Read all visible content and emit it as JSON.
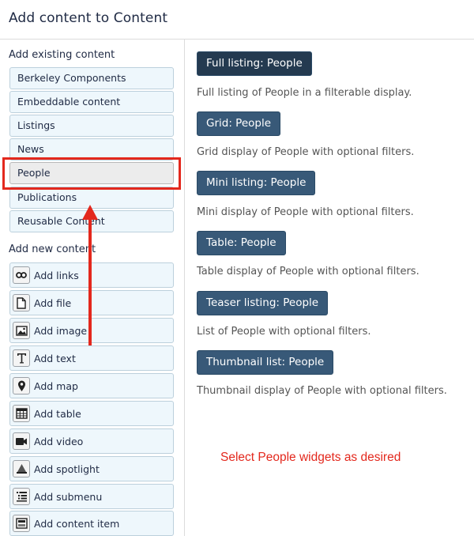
{
  "header": {
    "title": "Add content to Content"
  },
  "sidebar": {
    "existing_label": "Add existing content",
    "existing_items": [
      {
        "label": "Berkeley Components"
      },
      {
        "label": "Embeddable content"
      },
      {
        "label": "Listings"
      },
      {
        "label": "News"
      },
      {
        "label": "People",
        "selected": true
      },
      {
        "label": "Publications"
      },
      {
        "label": "Reusable Content"
      }
    ],
    "new_label": "Add new content",
    "new_items": [
      {
        "label": "Add links",
        "icon": "link-icon"
      },
      {
        "label": "Add file",
        "icon": "file-icon"
      },
      {
        "label": "Add image",
        "icon": "image-icon"
      },
      {
        "label": "Add text",
        "icon": "text-icon"
      },
      {
        "label": "Add map",
        "icon": "map-pin-icon"
      },
      {
        "label": "Add table",
        "icon": "table-icon"
      },
      {
        "label": "Add video",
        "icon": "video-camera-icon"
      },
      {
        "label": "Add spotlight",
        "icon": "spotlight-icon"
      },
      {
        "label": "Add submenu",
        "icon": "submenu-icon"
      },
      {
        "label": "Add content item",
        "icon": "content-item-icon"
      }
    ]
  },
  "main": {
    "widgets": [
      {
        "label": "Full listing: People",
        "description": "Full listing of People in a filterable display."
      },
      {
        "label": "Grid: People",
        "description": "Grid display of People with optional filters."
      },
      {
        "label": "Mini listing: People",
        "description": "Mini display of People with optional filters."
      },
      {
        "label": "Table: People",
        "description": "Table display of People with optional filters."
      },
      {
        "label": "Teaser listing: People",
        "description": "List of People with optional filters."
      },
      {
        "label": "Thumbnail list: People",
        "description": "Thumbnail display of People with optional filters."
      }
    ]
  },
  "annotation": {
    "note": "Select People widgets as desired",
    "color": "#e3281d"
  },
  "colors": {
    "widget_button": "#385978",
    "list_button_bg": "#eef7fc"
  }
}
